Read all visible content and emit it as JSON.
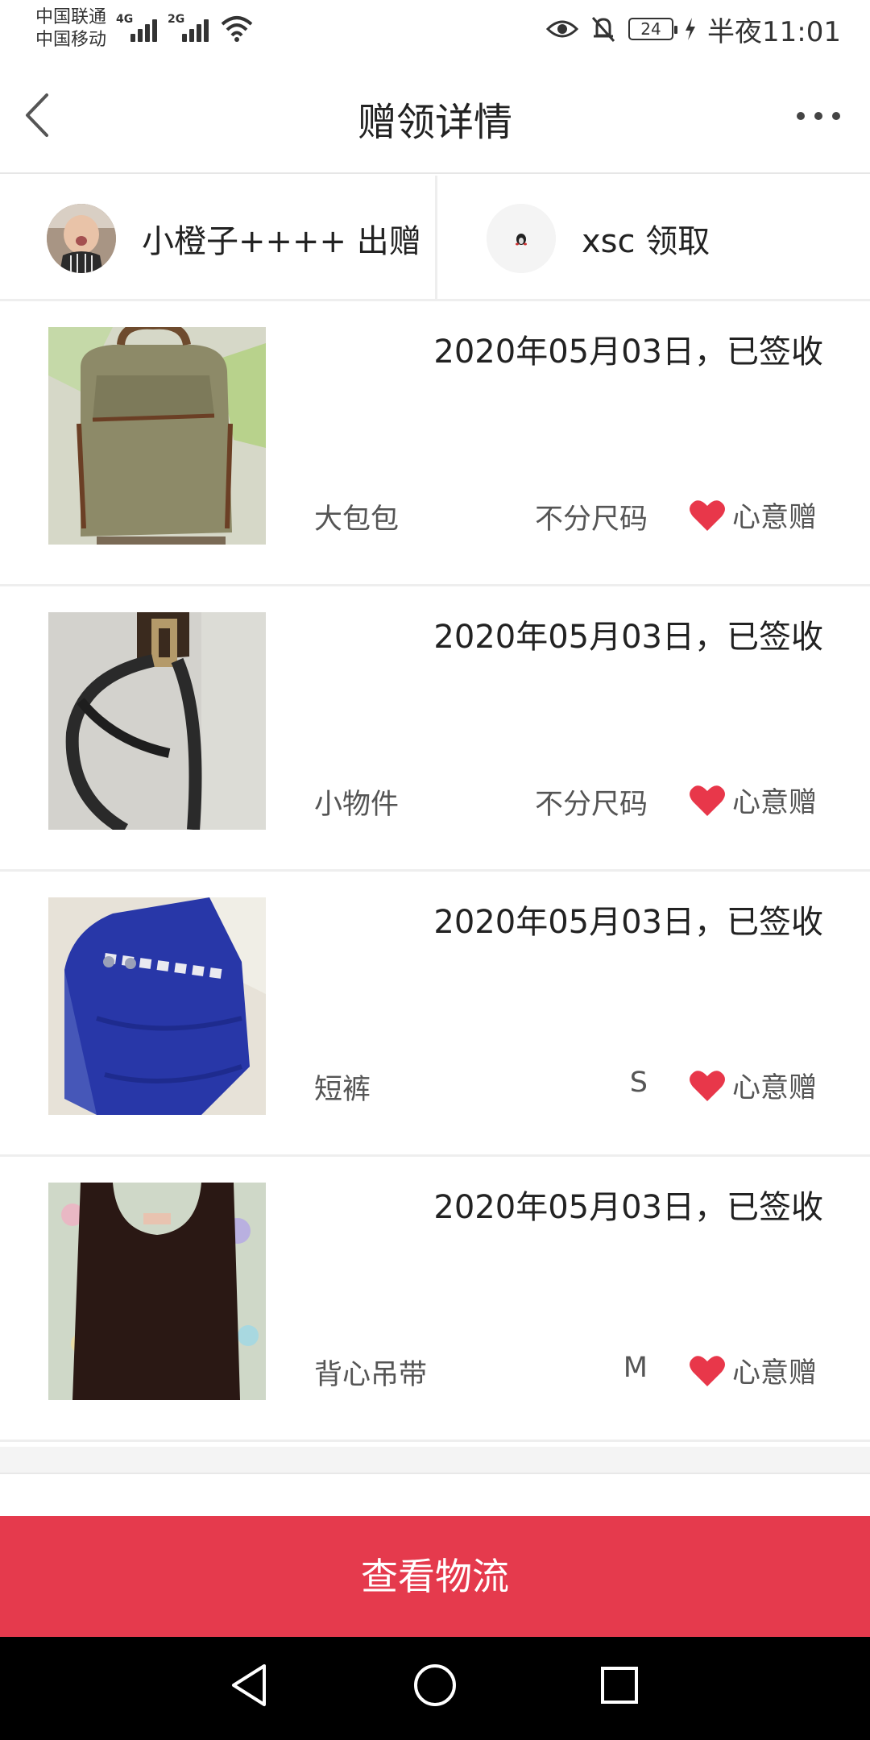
{
  "status_bar": {
    "carrier1": "中国联通",
    "carrier2": "中国移动",
    "net1": "4G",
    "net2": "2G",
    "battery": "24",
    "time": "半夜11:01"
  },
  "nav": {
    "title": "赠领详情",
    "back_icon": "chevron-left-icon",
    "more_icon": "more-horizontal-icon"
  },
  "parties": {
    "giver": "小橙子++++ 出赠",
    "receiver": "xsc 领取"
  },
  "items": [
    {
      "date": "2020年05月03日，已签收",
      "name": "大包包",
      "size": "不分尺码",
      "gift": "心意赠"
    },
    {
      "date": "2020年05月03日，已签收",
      "name": "小物件",
      "size": "不分尺码",
      "gift": "心意赠"
    },
    {
      "date": "2020年05月03日，已签收",
      "name": "短裤",
      "size": "S",
      "gift": "心意赠"
    },
    {
      "date": "2020年05月03日，已签收",
      "name": "背心吊带",
      "size": "M",
      "gift": "心意赠"
    }
  ],
  "colors": {
    "accent": "#e53a4d",
    "heart": "#e8374a"
  },
  "cta": {
    "label": "查看物流"
  },
  "system_nav": [
    "back-triangle-icon",
    "home-circle-icon",
    "recents-square-icon"
  ]
}
